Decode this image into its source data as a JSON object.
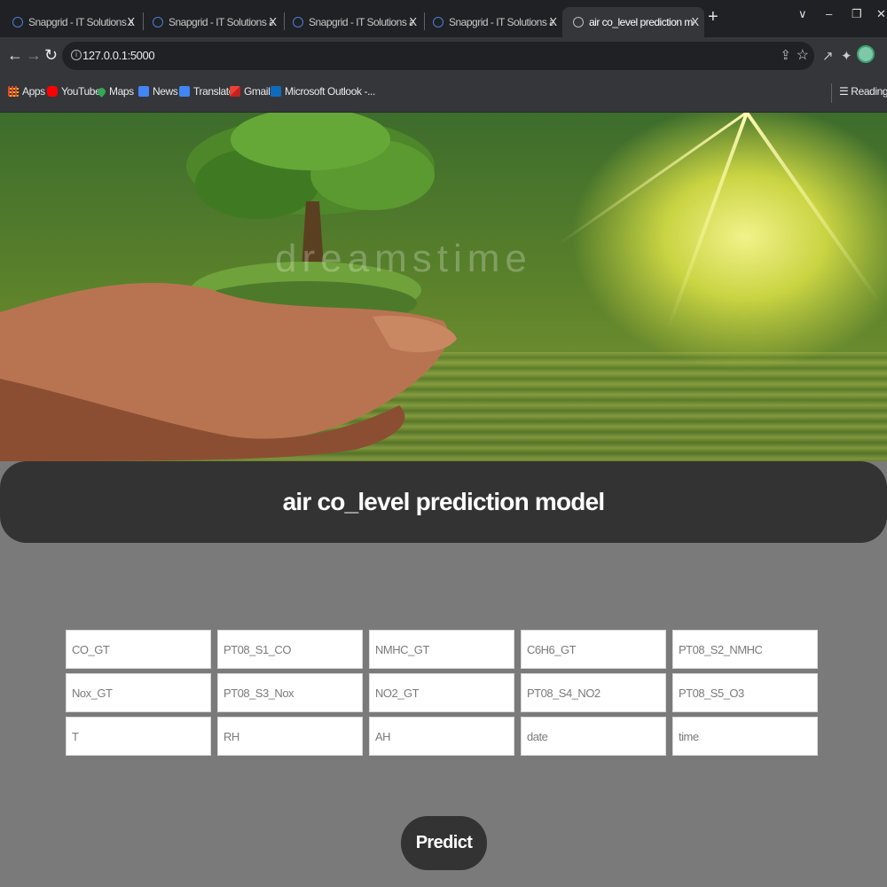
{
  "browser": {
    "tabs": [
      {
        "title": "Snapgrid - IT Solutions and Technology"
      },
      {
        "title": "Snapgrid - IT Solutions and Technology"
      },
      {
        "title": "Snapgrid - IT Solutions and Technology"
      },
      {
        "title": "Snapgrid - IT Solutions and Technology"
      },
      {
        "title": "air co_level prediction model",
        "active": true
      }
    ],
    "close_glyph": "X",
    "new_tab_glyph": "+",
    "url": "127.0.0.1:5000",
    "bookmarks": [
      {
        "label": "Apps",
        "icon": "apps-grid-icon",
        "color": "#ea4335"
      },
      {
        "label": "YouTube",
        "icon": "youtube-icon",
        "color": "#ff0000"
      },
      {
        "label": "Maps",
        "icon": "maps-pin-icon",
        "color": "#34a853"
      },
      {
        "label": "News",
        "icon": "news-icon",
        "color": "#4285f4"
      },
      {
        "label": "Translate",
        "icon": "translate-icon",
        "color": "#4285f4"
      },
      {
        "label": "Gmail",
        "icon": "gmail-icon",
        "color": "#ea4335"
      },
      {
        "label": "Microsoft Outlook -...",
        "icon": "outlook-icon",
        "color": "#0f6cbd"
      }
    ],
    "reading_list": "Reading list"
  },
  "hero": {
    "watermark": "dreamstime"
  },
  "page": {
    "title": "air co_level prediction model"
  },
  "form": {
    "fields": [
      {
        "placeholder": "CO_GT"
      },
      {
        "placeholder": "PT08_S1_CO"
      },
      {
        "placeholder": "NMHC_GT"
      },
      {
        "placeholder": "C6H6_GT"
      },
      {
        "placeholder": "PT08_S2_NMHC"
      },
      {
        "placeholder": "Nox_GT"
      },
      {
        "placeholder": "PT08_S3_Nox"
      },
      {
        "placeholder": "NO2_GT"
      },
      {
        "placeholder": "PT08_S4_NO2"
      },
      {
        "placeholder": "PT08_S5_O3"
      },
      {
        "placeholder": "T"
      },
      {
        "placeholder": "RH"
      },
      {
        "placeholder": "AH"
      },
      {
        "placeholder": "date"
      },
      {
        "placeholder": "time"
      }
    ],
    "submit_label": "Predict"
  },
  "colors": {
    "title_bar": "#333333",
    "page_background": "#7a7a7a",
    "button": "#333333"
  }
}
